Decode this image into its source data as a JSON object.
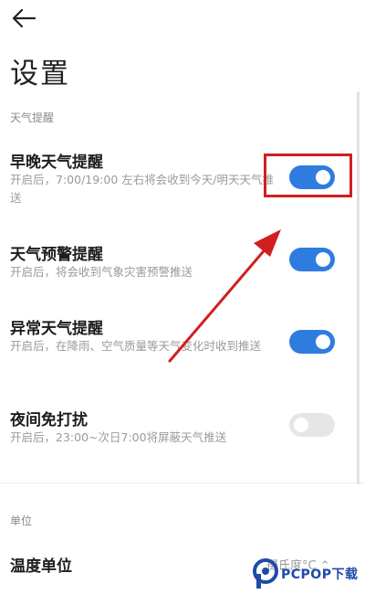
{
  "header": {
    "back_icon": "arrow-left-icon",
    "title": "设置"
  },
  "sections": {
    "weather_alerts": "天气提醒",
    "units": "单位"
  },
  "settings": [
    {
      "title": "早晚天气提醒",
      "subtitle": "开启后，7:00/19:00 左右将会收到今天/明天天气推送",
      "enabled": true
    },
    {
      "title": "天气预警提醒",
      "subtitle": "开启后，将会收到气象灾害预警推送",
      "enabled": true
    },
    {
      "title": "异常天气提醒",
      "subtitle": "开启后，在降雨、空气质量等天气变化时收到推送",
      "enabled": true
    },
    {
      "title": "夜间免打扰",
      "subtitle": "开启后，23:00~次日7:00将屏蔽天气推送",
      "enabled": false
    }
  ],
  "unit_setting": {
    "title": "温度单位",
    "value": "摄氏度°C"
  },
  "colors": {
    "toggle_on": "#2f7ce0",
    "toggle_off": "#e6e6e6",
    "annotation": "#d11f1f"
  },
  "watermark": {
    "text": "PCPOP下载"
  }
}
